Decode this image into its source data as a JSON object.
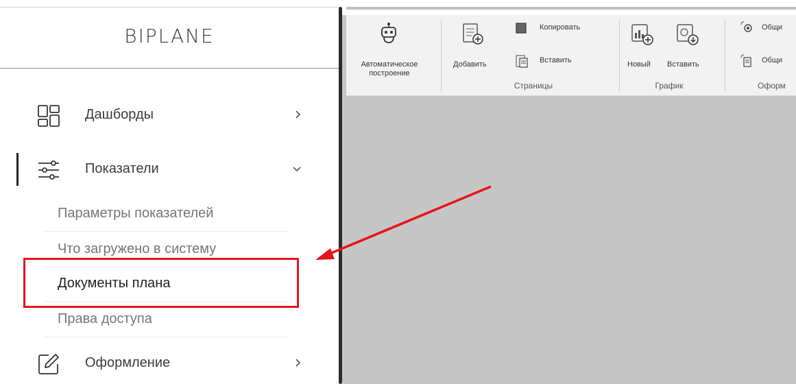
{
  "sidebar": {
    "logo": "BIPLANE",
    "items": [
      {
        "label": "Дашборды",
        "icon": "dashboard-icon",
        "chevron": "right"
      },
      {
        "label": "Показатели",
        "icon": "sliders-icon",
        "chevron": "down",
        "active": true
      },
      {
        "label": "Оформление",
        "icon": "edit-icon",
        "chevron": "right"
      }
    ],
    "subitems": [
      {
        "label": "Параметры показателей"
      },
      {
        "label": "Что загружено в систему"
      },
      {
        "label": "Документы плана",
        "highlighted": true
      },
      {
        "label": "Права доступа"
      }
    ]
  },
  "ribbon": {
    "auto_build": {
      "line1": "Автоматическое",
      "line2": "построение"
    },
    "pages_group": {
      "label": "Страницы",
      "add": "Добавить",
      "copy": "Копировать",
      "paste": "Вставить"
    },
    "chart_group": {
      "label": "График",
      "new": "Новый",
      "paste": "Вставить"
    },
    "design_group": {
      "label": "Оформ",
      "item1": "Общи",
      "item2": "Общи"
    }
  },
  "annotation": {
    "highlight_color": "#e8131b",
    "arrow_color": "#e8131b"
  }
}
